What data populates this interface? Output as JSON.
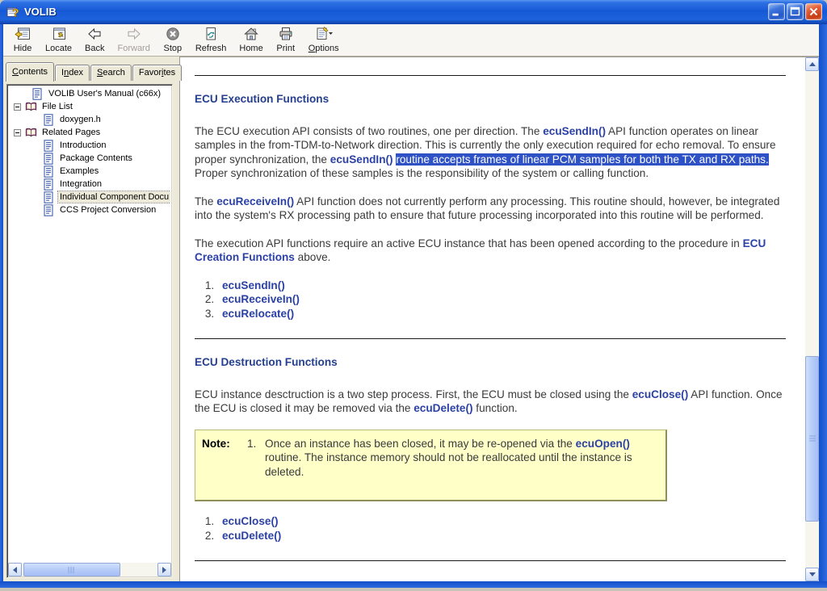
{
  "colors": {
    "selection": "#2E51C5",
    "link": "#2B41A5",
    "heading": "#25408F",
    "note_bg": "#FFFFC8",
    "titlebar_blue": "#1659D6",
    "window_border": "#1450C8"
  },
  "window": {
    "title": "VOLIB",
    "buttons": [
      "minimize",
      "maximize",
      "close"
    ]
  },
  "toolbar": {
    "buttons": [
      {
        "label": "Hide"
      },
      {
        "label": "Locate"
      },
      {
        "label": "Back"
      },
      {
        "label": "Forward",
        "disabled": true
      },
      {
        "label": "Stop"
      },
      {
        "label": "Refresh"
      },
      {
        "label": "Home"
      },
      {
        "label": "Print"
      },
      {
        "label": "Options",
        "underline": 0
      }
    ]
  },
  "sidebar": {
    "tabs": [
      {
        "label": "Contents",
        "underline": 0,
        "selected": true
      },
      {
        "label": "Index",
        "underline": 1
      },
      {
        "label": "Search",
        "underline": 0
      },
      {
        "label": "Favorites",
        "underline": 5
      }
    ],
    "tree": [
      {
        "label": "VOLIB User's Manual (c66x)",
        "icon": "page-icon",
        "level": 1
      },
      {
        "label": "File List",
        "icon": "book-icon",
        "level": 0,
        "expander": "minus"
      },
      {
        "label": "doxygen.h",
        "icon": "page-icon",
        "level": 2
      },
      {
        "label": "Related Pages",
        "icon": "book-icon",
        "level": 0,
        "expander": "minus"
      },
      {
        "label": "Introduction",
        "icon": "page-icon",
        "level": 2
      },
      {
        "label": "Package Contents",
        "icon": "page-icon",
        "level": 2
      },
      {
        "label": "Examples",
        "icon": "page-icon",
        "level": 2
      },
      {
        "label": "Integration",
        "icon": "page-icon",
        "level": 2
      },
      {
        "label": "Individual Component Docu",
        "icon": "page-icon",
        "level": 2,
        "selected": true
      },
      {
        "label": "CCS Project Conversion",
        "icon": "page-icon",
        "level": 2
      }
    ]
  },
  "content": {
    "sections": [
      {
        "heading": "ECU Execution Functions",
        "paragraphs": [
          [
            {
              "t": "The ECU execution API consists of two routines, one per direction. The ",
              "s": "plain"
            },
            {
              "t": "ecuSendIn()",
              "s": "link"
            },
            {
              "t": " API function operates on linear samples in the from-TDM-to-Network direction. This is currently the only execution required for echo removal. To ensure proper synchronization, the ",
              "s": "plain"
            },
            {
              "t": "ecuSendIn()",
              "s": "link"
            },
            {
              "t": " ",
              "s": "plain"
            },
            {
              "t": "routine accepts frames of linear PCM samples for both the TX and RX paths.",
              "s": "sel"
            },
            {
              "t": " Proper synchronization of these samples is the responsibility of the system or calling function.",
              "s": "plain"
            }
          ],
          [
            {
              "t": "The ",
              "s": "plain"
            },
            {
              "t": "ecuReceiveIn()",
              "s": "link"
            },
            {
              "t": " API function does not currently perform any processing. This routine should, however, be integrated into the system's RX processing path to ensure that future processing incorporated into this routine will be performed.",
              "s": "plain"
            }
          ],
          [
            {
              "t": "The execution API functions require an active ECU instance that has been opened according to the procedure in ",
              "s": "plain"
            },
            {
              "t": "ECU Creation Functions",
              "s": "link"
            },
            {
              "t": " above.",
              "s": "plain"
            }
          ]
        ],
        "list": [
          "ecuSendIn()",
          "ecuReceiveIn()",
          "ecuRelocate()"
        ]
      },
      {
        "heading": "ECU Destruction Functions",
        "paragraphs": [
          [
            {
              "t": "ECU instance desctruction is a two step process. First, the ECU must be closed using the ",
              "s": "plain"
            },
            {
              "t": "ecuClose()",
              "s": "link"
            },
            {
              "t": " API function. Once the ECU is closed it may be removed via the ",
              "s": "plain"
            },
            {
              "t": "ecuDelete()",
              "s": "link"
            },
            {
              "t": " function.",
              "s": "plain"
            }
          ]
        ],
        "note": {
          "label": "Note:",
          "number": "1.",
          "segments": [
            {
              "t": "Once an instance has been closed, it may be re-opened via the ",
              "s": "plain"
            },
            {
              "t": "ecuOpen()",
              "s": "link"
            },
            {
              "t": " routine. The instance memory should not be reallocated until the instance is deleted.",
              "s": "plain"
            }
          ]
        },
        "list": [
          "ecuClose()",
          "ecuDelete()"
        ]
      }
    ]
  }
}
